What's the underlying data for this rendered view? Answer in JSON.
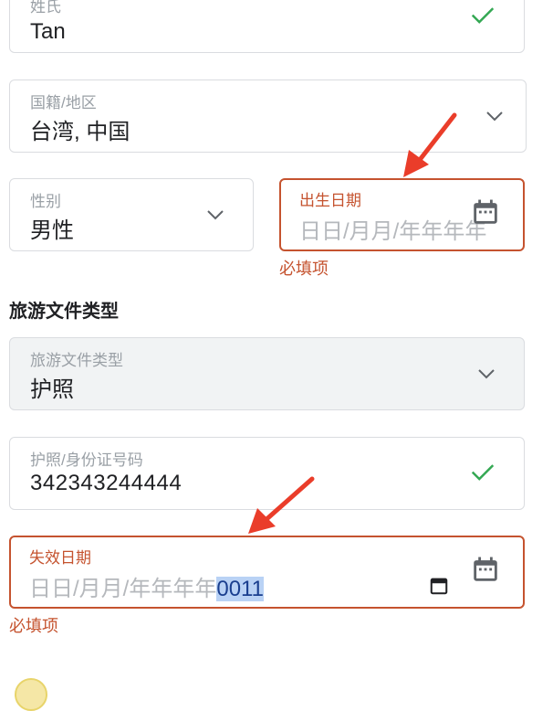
{
  "surname": {
    "label": "姓氏",
    "value": "Tan"
  },
  "nationality": {
    "label": "国籍/地区",
    "value": "台湾, 中国"
  },
  "gender": {
    "label": "性别",
    "value": "男性"
  },
  "birth_date": {
    "label": "出生日期",
    "placeholder": "日日/月月/年年年年",
    "error": "必填项"
  },
  "travel_doc_section_title": "旅游文件类型",
  "travel_doc_type": {
    "label": "旅游文件类型",
    "value": "护照"
  },
  "passport_number": {
    "label": "护照/身份证号码",
    "value": "342343244444"
  },
  "expiry_date": {
    "label": "失效日期",
    "placeholder": "日日/月月/年年年年",
    "selected_input": "0011",
    "error": "必填项"
  },
  "colors": {
    "error": "#c5532f",
    "check": "#34a853",
    "annotation_arrow": "#ea3d2a"
  }
}
